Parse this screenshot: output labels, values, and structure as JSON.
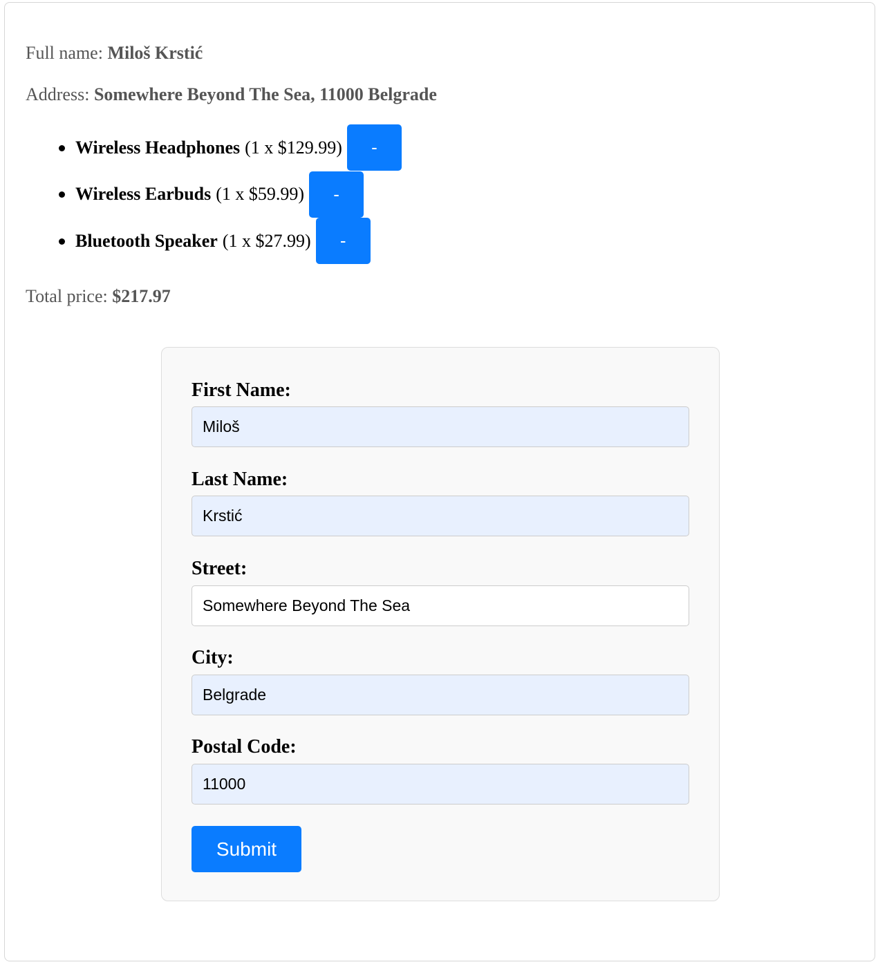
{
  "summary": {
    "fullname_label": "Full name:",
    "fullname_value": "Miloš Krstić",
    "address_label": "Address:",
    "address_value": "Somewhere Beyond The Sea, 11000 Belgrade",
    "total_label": "Total price:",
    "total_value": "$217.97"
  },
  "cart": {
    "items": [
      {
        "name": "Wireless Headphones",
        "qty_text": "(1 x $129.99)",
        "remove_label": "-"
      },
      {
        "name": "Wireless Earbuds",
        "qty_text": "(1 x $59.99)",
        "remove_label": "-"
      },
      {
        "name": "Bluetooth Speaker",
        "qty_text": "(1 x $27.99)",
        "remove_label": "-"
      }
    ]
  },
  "form": {
    "first_name": {
      "label": "First Name:",
      "value": "Miloš"
    },
    "last_name": {
      "label": "Last Name:",
      "value": "Krstić"
    },
    "street": {
      "label": "Street:",
      "value": "Somewhere Beyond The Sea"
    },
    "city": {
      "label": "City:",
      "value": "Belgrade"
    },
    "postal_code": {
      "label": "Postal Code:",
      "value": "11000"
    },
    "submit_label": "Submit"
  },
  "colors": {
    "accent": "#0a7cff",
    "autofill_bg": "#e8f0fe",
    "card_bg": "#f9f9f9",
    "summary_text": "#555555"
  }
}
